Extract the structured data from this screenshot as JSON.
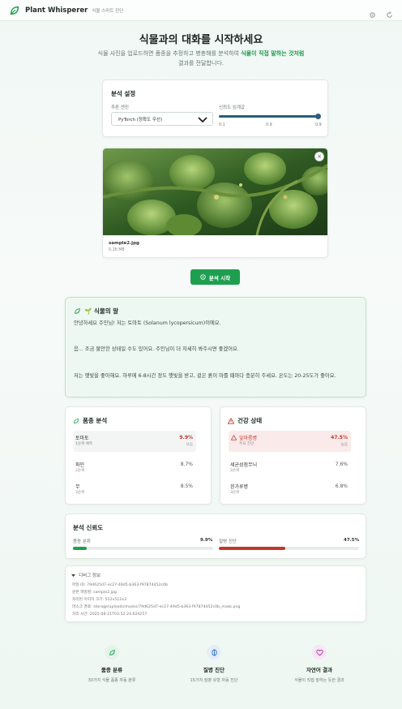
{
  "app": {
    "brand": "Plant Whisperer",
    "subtitle": "식물 스마트 진단"
  },
  "hero": {
    "title": "식물과의 대화를 시작하세요",
    "desc_prefix": "식물 사진을 업로드하면 품종을 추정하고 병충해를 분석하여 ",
    "desc_highlight": "식물이 직접 말하는 것처럼",
    "desc_suffix": " 결과를 전달합니다."
  },
  "settings": {
    "title": "분석 설정",
    "engine_label": "추론 엔진",
    "engine_value": "PyTorch (정확도 우선)",
    "threshold_label": "신뢰도 임계값",
    "threshold_value": 0.9,
    "threshold_ticks": [
      "0.1",
      "0.9",
      "0.9"
    ]
  },
  "upload": {
    "file_name": "sample2.jpg",
    "file_size": "0.26 MB",
    "close_label": "×"
  },
  "start_button": "분석 시작",
  "plant_speech": {
    "title": "🌱 식물의 말",
    "lines": [
      "안녕하세요 주인님! 저는 토마토 (Solanum lycopersicum)이에요.",
      "음... 조금 불안한 상태일 수도 있어요. 주인님이 더 자세히 봐주시면 좋겠어요.",
      "저는 햇빛을 좋아해요. 하루에 6-8시간 정도 햇빛을 받고, 겉은 흙이 마를 때마다 충분히 주세요. 온도는 20-25도가 좋아요."
    ]
  },
  "species": {
    "title": "품종 분석",
    "top": {
      "name": "토마토",
      "sub": "1순위 예측",
      "pct": "9.9%",
      "pct_sub": "낮음"
    },
    "items": [
      {
        "name": "파인",
        "sub": "2순위",
        "pct": "8.7%"
      },
      {
        "name": "무",
        "sub": "3순위",
        "pct": "8.5%"
      }
    ]
  },
  "health": {
    "title": "건강 상태",
    "top": {
      "name": "잎마름병",
      "sub": "주요 진단",
      "pct": "47.5%",
      "pct_sub": "높음"
    },
    "items": [
      {
        "name": "세균성점무늬",
        "sub": "2순위",
        "pct": "7.6%"
      },
      {
        "name": "흰가루병",
        "sub": "3순위",
        "pct": "6.8%"
      }
    ]
  },
  "confidence": {
    "title": "분석 신뢰도",
    "species_label": "품종 분류",
    "species_pct": "9.9%",
    "species_value": 0.099,
    "disease_label": "질병 진단",
    "disease_pct": "47.5%",
    "disease_value": 0.475
  },
  "debug": {
    "title": "디버그 정보",
    "lines": [
      "파일 ID: 79d625d7-ec27-49d5-b363-f97874452c0b",
      "원본 파일명: sample2.jpg",
      "처리된 이미지 크기: 512x512x3",
      "마스크 경로: storage/uploads/masks/79d625d7-ec27-49d5-b363-f97874452c0b_mask.png",
      "처리 시간: 2025-08-21T03:52:24.624257"
    ]
  },
  "features": [
    {
      "title": "품종 분류",
      "desc": "30가지 식물 품종 자동 분류",
      "color": "#e3f5ea",
      "icon": "leaf-icon"
    },
    {
      "title": "질병 진단",
      "desc": "15가지 질병 유형 자동 진단",
      "color": "#e4eef9",
      "icon": "shield-icon"
    },
    {
      "title": "자연어 결과",
      "desc": "식물이 직접 말하는 듯한 결과",
      "color": "#f7e6f5",
      "icon": "heart-icon"
    }
  ],
  "colors": {
    "accent": "#1e9f50",
    "danger": "#c0392b",
    "slider": "#2c5d7c"
  }
}
